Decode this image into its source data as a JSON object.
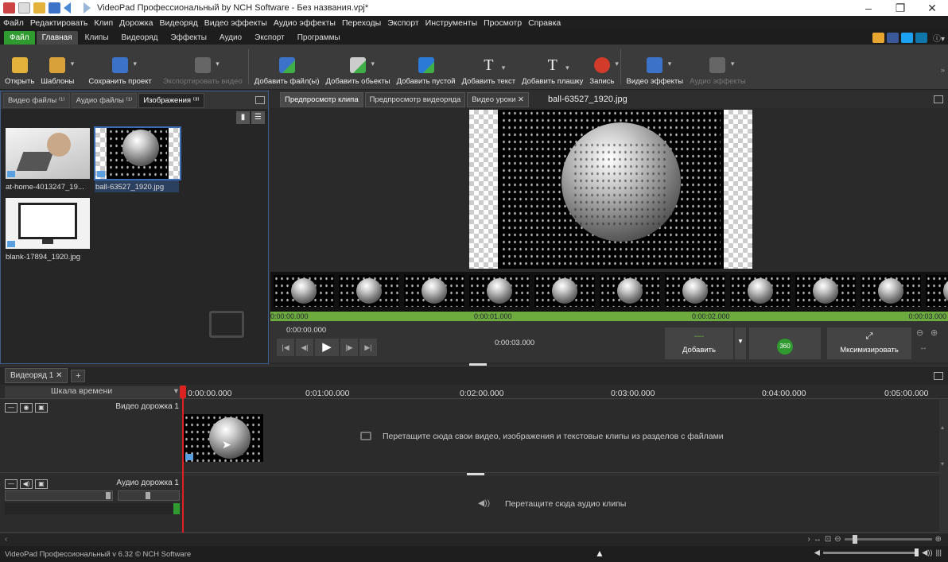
{
  "app": {
    "title": "VideoPad Профессиональный by NCH Software - Без названия.vpj*",
    "window_controls": [
      "–",
      "❐",
      "✕"
    ]
  },
  "menu": [
    "Файл",
    "Редактировать",
    "Клип",
    "Дорожка",
    "Видеоряд",
    "Видео эффекты",
    "Аудио эффекты",
    "Переходы",
    "Экспорт",
    "Инструменты",
    "Просмотр",
    "Справка"
  ],
  "ribbon_tabs": [
    {
      "label": "Файл",
      "kind": "file"
    },
    {
      "label": "Главная",
      "kind": "active"
    },
    {
      "label": "Клипы",
      "kind": ""
    },
    {
      "label": "Видеоряд",
      "kind": ""
    },
    {
      "label": "Эффекты",
      "kind": ""
    },
    {
      "label": "Аудио",
      "kind": ""
    },
    {
      "label": "Экспорт",
      "kind": ""
    },
    {
      "label": "Программы",
      "kind": ""
    }
  ],
  "toolbar": {
    "open": "Открыть",
    "templates": "Шаблоны",
    "save_project": "Сохранить проект",
    "export_video": "Экспортировать видео",
    "add_files": "Добавить файл(ы)",
    "add_objects": "Добавить обьекты",
    "add_blank": "Добавить пустой",
    "add_text": "Добавить текст",
    "add_caption": "Добавить плашку",
    "record": "Запись",
    "video_effects": "Видео эффекты",
    "audio_effects": "Аудио эффекты",
    "more": "»"
  },
  "left_panel": {
    "tabs": [
      "Видео файлы ⁽¹⁾",
      "Аудио файлы ⁽¹⁾",
      "Изображения ⁽³⁾"
    ],
    "active_tab": 2,
    "items": [
      {
        "name": "at-home-4013247_19...",
        "selected": false
      },
      {
        "name": "ball-63527_1920.jpg",
        "selected": true
      },
      {
        "name": "blank-17894_1920.jpg",
        "selected": false
      }
    ]
  },
  "preview": {
    "tabs": [
      "Предпросмотр клипа",
      "Предпросмотр видеоряда",
      "Видео уроки ✕"
    ],
    "active_tab": 0,
    "filename": "ball-63527_1920.jpg",
    "time_markers": [
      "0:00:00.000",
      "0:00:01.000",
      "0:00:02.000",
      "0:00:03.000"
    ],
    "current_time": "0:00:00.000",
    "duration": "0:00:03.000",
    "add_label": "Добавить",
    "btn_360": "360",
    "maximize_label": "Мксимизировать"
  },
  "sequence": {
    "tab": "Видеоряд 1 ✕",
    "timeline_label": "Шкала времени",
    "ruler": [
      "0:00:00.000",
      "0:01:00.000",
      "0:02:00.000",
      "0:03:00.000",
      "0:04:00.000",
      "0:05:00.000"
    ],
    "video_track": "Видео дорожка 1",
    "audio_track": "Аудио дорожка 1",
    "video_hint": "Перетащите сюда свои видео, изображения и текстовые клипы из разделов с файлами",
    "audio_hint": "Перетащите сюда аудио клипы"
  },
  "status": {
    "text": "VideoPad Профессиональный v 6.32 © NCH Software"
  },
  "colors": {
    "accent_green": "#6dab3f",
    "file_tab": "#2f9a2f",
    "playhead": "#d22222",
    "selection": "#3a6cb5"
  }
}
